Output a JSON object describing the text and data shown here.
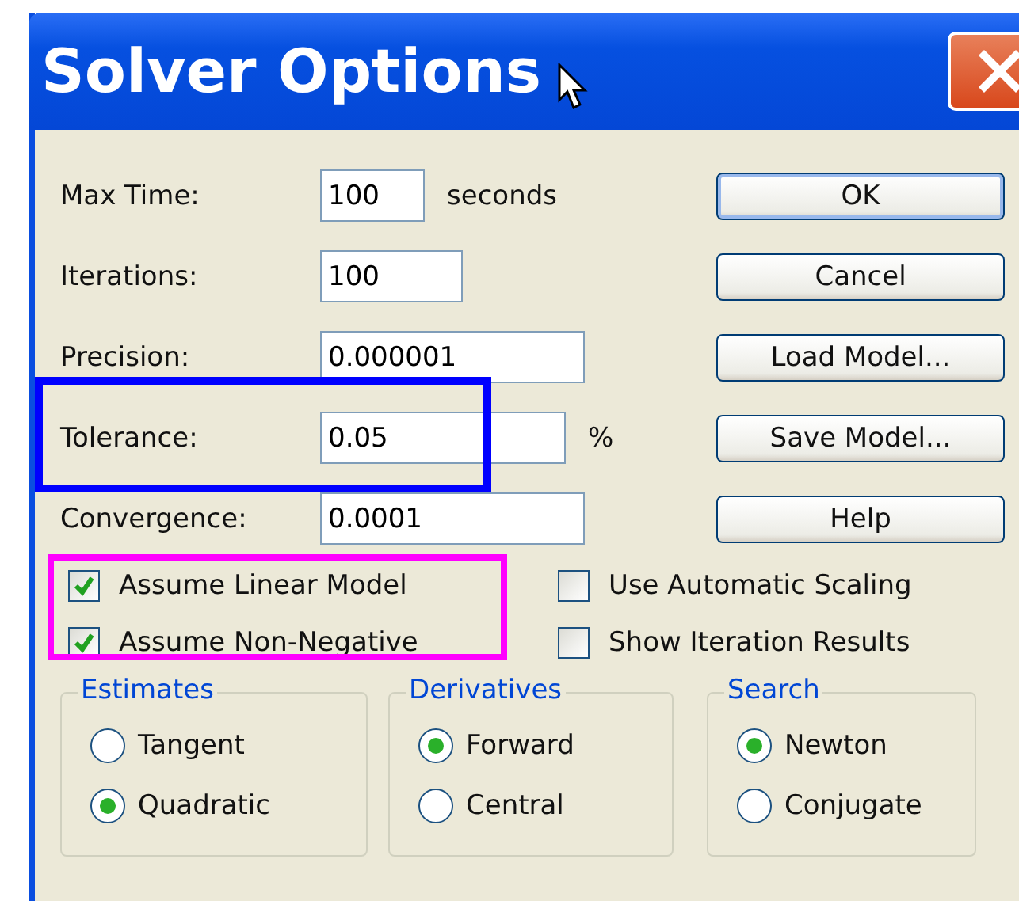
{
  "window": {
    "title": "Solver Options"
  },
  "fields": [
    {
      "label": "Max Time:",
      "value": "100",
      "unit": "seconds"
    },
    {
      "label": "Iterations:",
      "value": "100"
    },
    {
      "label": "Precision:",
      "value": "0.000001"
    },
    {
      "label": "Tolerance:",
      "value": "0.05",
      "unit": "%"
    },
    {
      "label": "Convergence:",
      "value": "0.0001"
    }
  ],
  "buttons": [
    {
      "label": "OK",
      "default": true
    },
    {
      "label": "Cancel",
      "default": false
    },
    {
      "label": "Load Model...",
      "default": false
    },
    {
      "label": "Save Model...",
      "default": false
    },
    {
      "label": "Help",
      "default": false
    }
  ],
  "checkboxes": [
    {
      "label": "Assume Linear Model",
      "checked": true
    },
    {
      "label": "Use Automatic Scaling",
      "checked": false
    },
    {
      "label": "Assume Non-Negative",
      "checked": true
    },
    {
      "label": "Show Iteration Results",
      "checked": false
    }
  ],
  "groups": [
    {
      "title": "Estimates",
      "options": [
        {
          "label": "Tangent",
          "selected": false
        },
        {
          "label": "Quadratic",
          "selected": true
        }
      ]
    },
    {
      "title": "Derivatives",
      "options": [
        {
          "label": "Forward",
          "selected": true
        },
        {
          "label": "Central",
          "selected": false
        }
      ]
    },
    {
      "title": "Search",
      "options": [
        {
          "label": "Newton",
          "selected": true
        },
        {
          "label": "Conjugate",
          "selected": false
        }
      ]
    }
  ],
  "annotations": [
    {
      "color": "#0000ff"
    },
    {
      "color": "#ff00ff"
    }
  ]
}
